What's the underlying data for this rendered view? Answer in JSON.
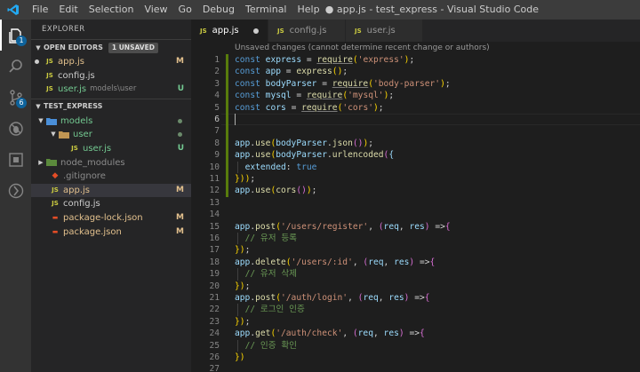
{
  "titlebar": {
    "menu": [
      "File",
      "Edit",
      "Selection",
      "View",
      "Go",
      "Debug",
      "Terminal",
      "Help"
    ],
    "window_title": "● app.js - test_express - Visual Studio Code"
  },
  "activity": {
    "explorer_badge": "1",
    "scm_badge": "6"
  },
  "sidebar": {
    "title": "EXPLORER",
    "open_editors": {
      "label": "OPEN EDITORS",
      "badge": "1 UNSAVED",
      "items": [
        {
          "name": "app.js",
          "flag": "M"
        },
        {
          "name": "config.js",
          "flag": ""
        },
        {
          "name": "user.js",
          "sub": "models\\user",
          "flag": "U"
        }
      ]
    },
    "workspace": {
      "label": "TEST_EXPRESS",
      "items": [
        {
          "name": "models"
        },
        {
          "name": "user"
        },
        {
          "name": "user.js",
          "flag": "U"
        },
        {
          "name": "node_modules"
        },
        {
          "name": ".gitignore"
        },
        {
          "name": "app.js",
          "flag": "M"
        },
        {
          "name": "config.js"
        },
        {
          "name": "package-lock.json",
          "flag": "M"
        },
        {
          "name": "package.json",
          "flag": "M"
        }
      ]
    }
  },
  "tabs": [
    {
      "label": "app.js",
      "icon": "JS"
    },
    {
      "label": "config.js",
      "icon": "JS"
    },
    {
      "label": "user.js",
      "icon": "JS"
    }
  ],
  "editor": {
    "codelens": "Unsaved changes (cannot determine recent change or authors)",
    "lines": [
      "const express = require('express');",
      "const app = express();",
      "const bodyParser = require('body-parser');",
      "const mysql = require('mysql');",
      "const cors = require('cors');",
      "",
      "",
      "app.use(bodyParser.json());",
      "app.use(bodyParser.urlencoded({",
      "  extended: true",
      "}));",
      "app.use(cors());",
      "",
      "",
      "app.post('/users/register', (req, res) =>{",
      "  // 유저 등록",
      "});",
      "app.delete('/users/:id', (req, res) =>{",
      "  // 유저 삭제",
      "});",
      "app.post('/auth/login', (req, res) =>{",
      "  // 로그인 인증",
      "});",
      "app.get('/auth/check', (req, res) =>{",
      "  // 인증 확인",
      "})",
      ""
    ],
    "line_numbers": [
      "1",
      "2",
      "3",
      "4",
      "5",
      "6",
      "7",
      "8",
      "9",
      "10",
      "11",
      "12",
      "13",
      "14",
      "15",
      "16",
      "17",
      "18",
      "19",
      "20",
      "21",
      "22",
      "23",
      "24",
      "25",
      "26",
      "27"
    ],
    "current_line": 6
  }
}
